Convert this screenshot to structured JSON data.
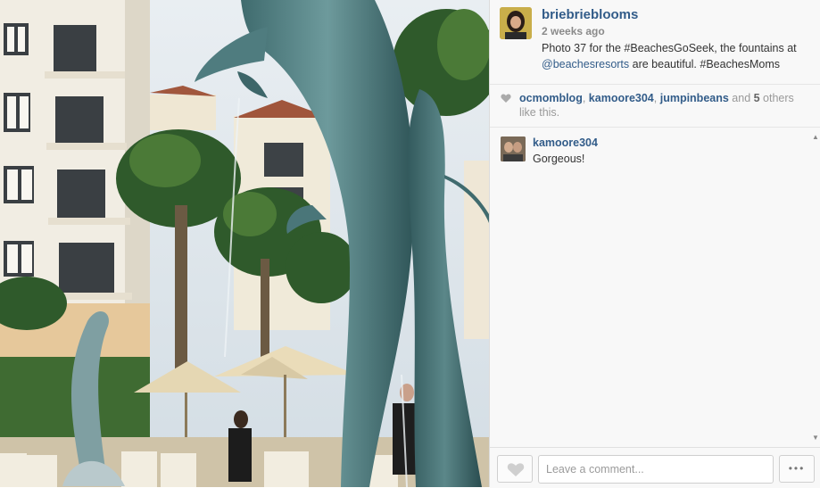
{
  "post": {
    "username": "briebrieblooms",
    "time_ago": "2 weeks ago",
    "caption_prefix": "Photo 37 for the #BeachesGoSeek, the fountains at ",
    "caption_mention": "@beachesresorts",
    "caption_suffix": " are beautiful. #BeachesMoms"
  },
  "likes": {
    "user1": "ocmomblog",
    "sep1": ", ",
    "user2": "kamoore304",
    "sep2": ", ",
    "user3": "jumpinbeans",
    "and_text": " and ",
    "others_count": "5",
    "others_text": " others like this."
  },
  "comments": [
    {
      "user": "kamoore304",
      "text": "Gorgeous!"
    }
  ],
  "footer": {
    "comment_placeholder": "Leave a comment...",
    "more_label": "•••"
  },
  "icons": {
    "like": "heart-icon",
    "more": "ellipsis-icon",
    "scroll_up": "arrow-up-icon",
    "scroll_down": "arrow-down-icon"
  },
  "colors": {
    "link": "#325c89",
    "muted": "#8a8a8a",
    "panel_bg": "#f8f8f8"
  }
}
